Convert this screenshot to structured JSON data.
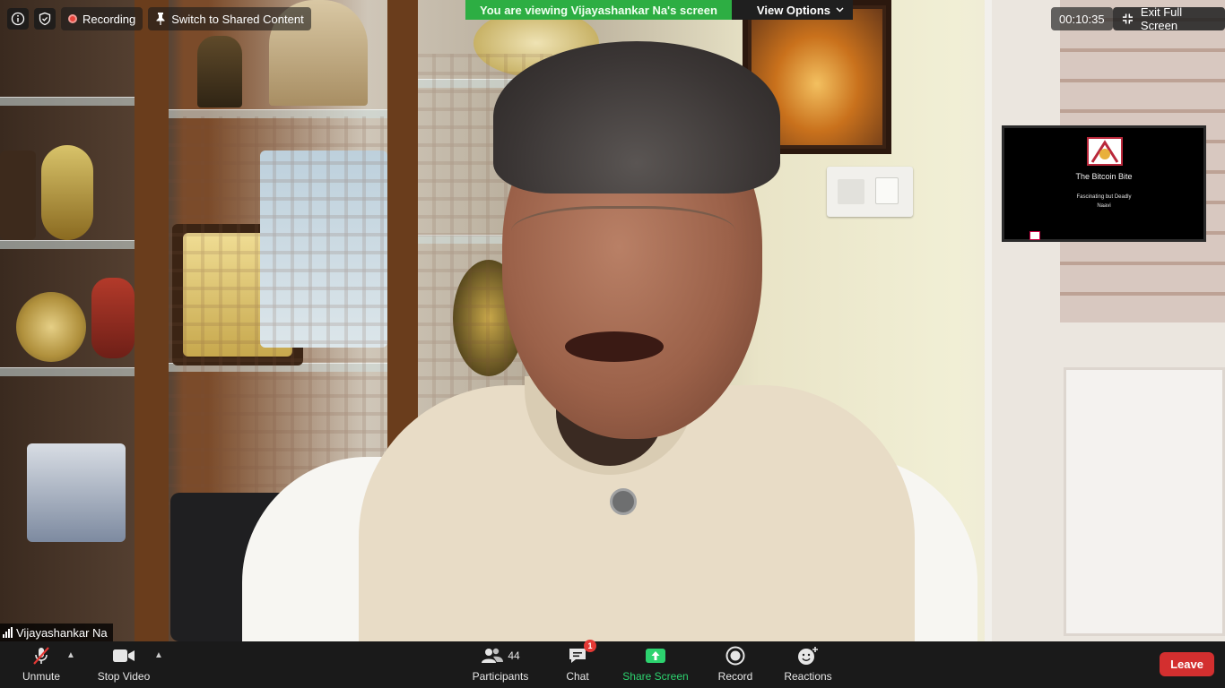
{
  "meeting": {
    "viewing_banner": "You are viewing Vijayashankar Na's screen",
    "view_options_label": "View Options",
    "recording_label": "Recording",
    "switch_label": "Switch to Shared Content",
    "timer": "00:10:35",
    "exit_fullscreen_label": "Exit Full Screen"
  },
  "shared_screen": {
    "title": "The Bitcoin Bite",
    "subtitle": "Fascinating but Deadly",
    "author": "Naavi"
  },
  "participant": {
    "name": "Vijayashankar Na"
  },
  "toolbar": {
    "unmute_label": "Unmute",
    "stop_video_label": "Stop Video",
    "participants_label": "Participants",
    "participants_count": "44",
    "chat_label": "Chat",
    "chat_badge": "1",
    "share_label": "Share Screen",
    "record_label": "Record",
    "reactions_label": "Reactions",
    "leave_label": "Leave"
  },
  "colors": {
    "banner_green": "#2dae43",
    "share_green": "#2dd36f",
    "leave_red": "#d32f2f",
    "toolbar_bg": "#1a1a1a"
  }
}
